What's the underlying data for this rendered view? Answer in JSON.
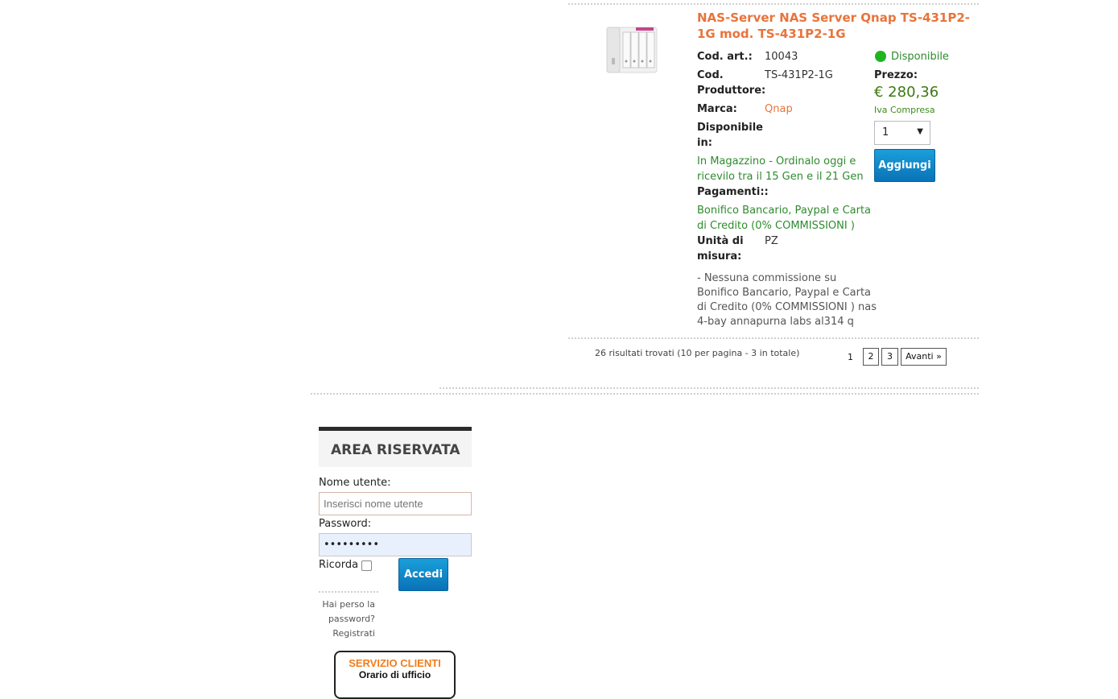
{
  "product": {
    "title": "NAS-Server NAS Server Qnap TS-431P2-1G mod. TS-431P2-1G",
    "cod_art_label": "Cod. art.:",
    "cod_art_value": "10043",
    "cod_prod_label_1": "Cod.",
    "cod_prod_label_2": "Produttore:",
    "cod_prod_value": "TS-431P2-1G",
    "marca_label": "Marca:",
    "marca_value": "Qnap",
    "disp_in_label_1": "Disponibile",
    "disp_in_label_2": "in:",
    "disp_in_value_1": "In Magazzino - Ordinalo oggi e",
    "disp_in_value_2": "ricevilo tra il 15 Gen e il 21 Gen",
    "pagamenti_label": "Pagamenti::",
    "pagamenti_value_1": "Bonifico Bancario, Paypal e Carta",
    "pagamenti_value_2": "di Credito (0% COMMISSIONI )",
    "unita_label_1": "Unità di",
    "unita_label_2": "misura:",
    "unita_value": "PZ",
    "description_lines": [
      "- Nessuna commissione su",
      "Bonifico Bancario, Paypal e Carta",
      "di Credito (0% COMMISSIONI ) nas",
      "4-bay annapurna labs al314 q"
    ],
    "availability": "Disponibile",
    "availability_color": "#1fb51f",
    "price_label": "Prezzo:",
    "price": "€ 280,36",
    "vat_note": "Iva Compresa",
    "qty_value": "1",
    "add_button": "Aggiungi"
  },
  "pagination": {
    "summary": "26 risultati trovati (10 per pagina - 3 in totale)",
    "pages": [
      "1",
      "2",
      "3"
    ],
    "next": "Avanti »"
  },
  "login": {
    "heading": "AREA RISERVATA",
    "username_label": "Nome utente:",
    "username_placeholder": "Inserisci nome utente",
    "password_label": "Password:",
    "password_value": "•••••••••",
    "remember_label": "Ricorda",
    "submit": "Accedi",
    "forgot_line_1": "Hai perso la",
    "forgot_line_2": "password?",
    "register": "Registrati"
  },
  "banner": {
    "line1": "SERVIZIO CLIENTI",
    "line2": "Orario di ufficio"
  }
}
